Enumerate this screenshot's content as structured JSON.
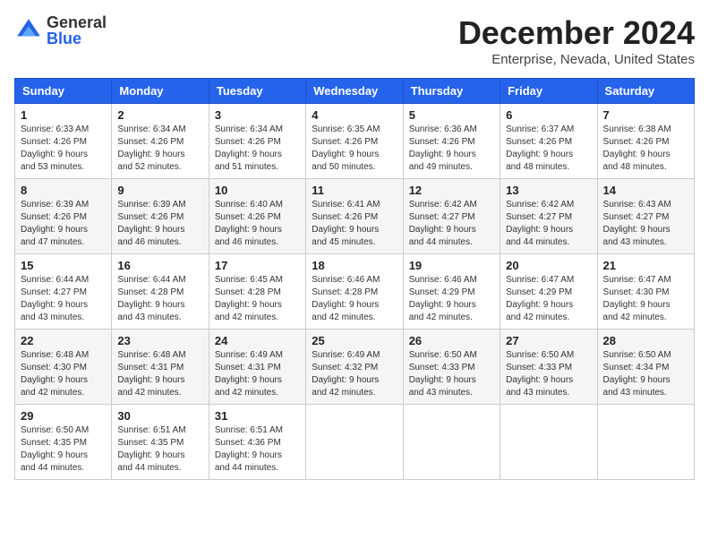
{
  "logo": {
    "general": "General",
    "blue": "Blue"
  },
  "title": {
    "month": "December 2024",
    "location": "Enterprise, Nevada, United States"
  },
  "weekdays": [
    "Sunday",
    "Monday",
    "Tuesday",
    "Wednesday",
    "Thursday",
    "Friday",
    "Saturday"
  ],
  "weeks": [
    [
      {
        "day": "1",
        "info": "Sunrise: 6:33 AM\nSunset: 4:26 PM\nDaylight: 9 hours\nand 53 minutes."
      },
      {
        "day": "2",
        "info": "Sunrise: 6:34 AM\nSunset: 4:26 PM\nDaylight: 9 hours\nand 52 minutes."
      },
      {
        "day": "3",
        "info": "Sunrise: 6:34 AM\nSunset: 4:26 PM\nDaylight: 9 hours\nand 51 minutes."
      },
      {
        "day": "4",
        "info": "Sunrise: 6:35 AM\nSunset: 4:26 PM\nDaylight: 9 hours\nand 50 minutes."
      },
      {
        "day": "5",
        "info": "Sunrise: 6:36 AM\nSunset: 4:26 PM\nDaylight: 9 hours\nand 49 minutes."
      },
      {
        "day": "6",
        "info": "Sunrise: 6:37 AM\nSunset: 4:26 PM\nDaylight: 9 hours\nand 48 minutes."
      },
      {
        "day": "7",
        "info": "Sunrise: 6:38 AM\nSunset: 4:26 PM\nDaylight: 9 hours\nand 48 minutes."
      }
    ],
    [
      {
        "day": "8",
        "info": "Sunrise: 6:39 AM\nSunset: 4:26 PM\nDaylight: 9 hours\nand 47 minutes."
      },
      {
        "day": "9",
        "info": "Sunrise: 6:39 AM\nSunset: 4:26 PM\nDaylight: 9 hours\nand 46 minutes."
      },
      {
        "day": "10",
        "info": "Sunrise: 6:40 AM\nSunset: 4:26 PM\nDaylight: 9 hours\nand 46 minutes."
      },
      {
        "day": "11",
        "info": "Sunrise: 6:41 AM\nSunset: 4:26 PM\nDaylight: 9 hours\nand 45 minutes."
      },
      {
        "day": "12",
        "info": "Sunrise: 6:42 AM\nSunset: 4:27 PM\nDaylight: 9 hours\nand 44 minutes."
      },
      {
        "day": "13",
        "info": "Sunrise: 6:42 AM\nSunset: 4:27 PM\nDaylight: 9 hours\nand 44 minutes."
      },
      {
        "day": "14",
        "info": "Sunrise: 6:43 AM\nSunset: 4:27 PM\nDaylight: 9 hours\nand 43 minutes."
      }
    ],
    [
      {
        "day": "15",
        "info": "Sunrise: 6:44 AM\nSunset: 4:27 PM\nDaylight: 9 hours\nand 43 minutes."
      },
      {
        "day": "16",
        "info": "Sunrise: 6:44 AM\nSunset: 4:28 PM\nDaylight: 9 hours\nand 43 minutes."
      },
      {
        "day": "17",
        "info": "Sunrise: 6:45 AM\nSunset: 4:28 PM\nDaylight: 9 hours\nand 42 minutes."
      },
      {
        "day": "18",
        "info": "Sunrise: 6:46 AM\nSunset: 4:28 PM\nDaylight: 9 hours\nand 42 minutes."
      },
      {
        "day": "19",
        "info": "Sunrise: 6:46 AM\nSunset: 4:29 PM\nDaylight: 9 hours\nand 42 minutes."
      },
      {
        "day": "20",
        "info": "Sunrise: 6:47 AM\nSunset: 4:29 PM\nDaylight: 9 hours\nand 42 minutes."
      },
      {
        "day": "21",
        "info": "Sunrise: 6:47 AM\nSunset: 4:30 PM\nDaylight: 9 hours\nand 42 minutes."
      }
    ],
    [
      {
        "day": "22",
        "info": "Sunrise: 6:48 AM\nSunset: 4:30 PM\nDaylight: 9 hours\nand 42 minutes."
      },
      {
        "day": "23",
        "info": "Sunrise: 6:48 AM\nSunset: 4:31 PM\nDaylight: 9 hours\nand 42 minutes."
      },
      {
        "day": "24",
        "info": "Sunrise: 6:49 AM\nSunset: 4:31 PM\nDaylight: 9 hours\nand 42 minutes."
      },
      {
        "day": "25",
        "info": "Sunrise: 6:49 AM\nSunset: 4:32 PM\nDaylight: 9 hours\nand 42 minutes."
      },
      {
        "day": "26",
        "info": "Sunrise: 6:50 AM\nSunset: 4:33 PM\nDaylight: 9 hours\nand 43 minutes."
      },
      {
        "day": "27",
        "info": "Sunrise: 6:50 AM\nSunset: 4:33 PM\nDaylight: 9 hours\nand 43 minutes."
      },
      {
        "day": "28",
        "info": "Sunrise: 6:50 AM\nSunset: 4:34 PM\nDaylight: 9 hours\nand 43 minutes."
      }
    ],
    [
      {
        "day": "29",
        "info": "Sunrise: 6:50 AM\nSunset: 4:35 PM\nDaylight: 9 hours\nand 44 minutes."
      },
      {
        "day": "30",
        "info": "Sunrise: 6:51 AM\nSunset: 4:35 PM\nDaylight: 9 hours\nand 44 minutes."
      },
      {
        "day": "31",
        "info": "Sunrise: 6:51 AM\nSunset: 4:36 PM\nDaylight: 9 hours\nand 44 minutes."
      },
      null,
      null,
      null,
      null
    ]
  ]
}
